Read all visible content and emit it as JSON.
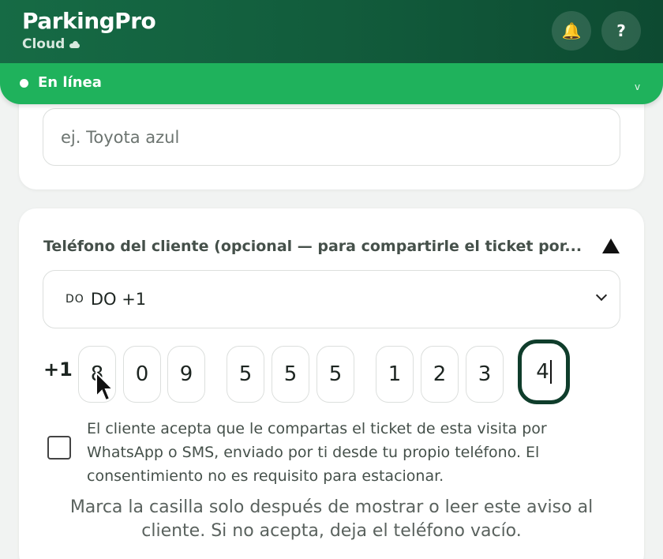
{
  "header": {
    "brand": "ParkingPro",
    "subtitle": "Cloud",
    "bell_icon": "bell-icon",
    "help_label": "?"
  },
  "status": {
    "label": "En línea",
    "chevron": "v",
    "dot_color": "#ffffff",
    "bar_color": "#1fb25c"
  },
  "vehicle": {
    "placeholder": "ej. Toyota azul"
  },
  "phone": {
    "title": "Teléfono del cliente (opcional — para compartirle el ticket por...",
    "country": {
      "flag": "DO",
      "label": "DO +1"
    },
    "prefix": "+1",
    "digits": [
      "8",
      "0",
      "9",
      "5",
      "5",
      "5",
      "1",
      "2",
      "3",
      "4"
    ]
  },
  "consent": {
    "text": "El cliente acepta que le compartas el ticket de esta visita por WhatsApp o SMS, enviado por ti desde tu propio teléfono. El consentimiento no es requisito para estacionar.",
    "checked": false
  },
  "hint": "Marca la casilla solo después de mostrar o leer este aviso al cliente. Si no acepta, deja el teléfono vacío."
}
